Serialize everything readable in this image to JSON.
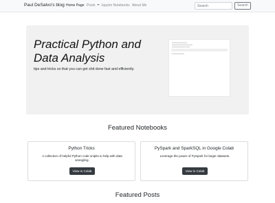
{
  "navbar": {
    "brand": "Paul DeSalvo's blog",
    "items": [
      {
        "label": "Home Page",
        "active": true
      },
      {
        "label": "Posts",
        "dropdown": true
      },
      {
        "label": "Jupyter Notebooks"
      },
      {
        "label": "About Me"
      }
    ],
    "search_placeholder": "Search",
    "search_button": "Search"
  },
  "hero": {
    "title": "Practical Python and Data Analysis",
    "subtitle": "tips and tricks so that you can get shit done fast and efficiently."
  },
  "featured_notebooks": {
    "heading": "Featured Notebooks",
    "cards": [
      {
        "title": "Python Tricks",
        "text": "A collection of helpful Python code snipits to help with data wrangling.",
        "button": "View in Colab"
      },
      {
        "title": "PySpark and SparkSQL in Google Colab",
        "text": "Leverage the power of PySpark for larger datasets.",
        "button": "View in Colab"
      }
    ]
  },
  "featured_posts": {
    "heading": "Featured Posts"
  },
  "colors": {
    "navbar_bg": "#f8f9fa",
    "jumbotron_bg": "#f1f1f1",
    "button_dark": "#343a40"
  }
}
